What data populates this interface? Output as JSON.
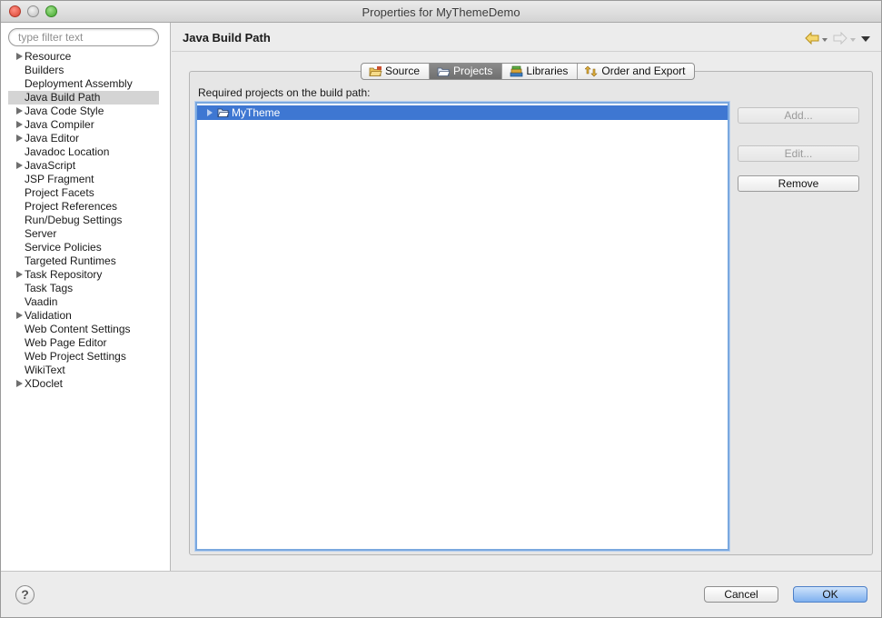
{
  "window": {
    "title": "Properties for MyThemeDemo"
  },
  "filter": {
    "placeholder": "type filter text",
    "value": ""
  },
  "tree": {
    "items": [
      {
        "label": "Resource",
        "expandable": true
      },
      {
        "label": "Builders",
        "expandable": false
      },
      {
        "label": "Deployment Assembly",
        "expandable": false
      },
      {
        "label": "Java Build Path",
        "expandable": false,
        "selected": true
      },
      {
        "label": "Java Code Style",
        "expandable": true
      },
      {
        "label": "Java Compiler",
        "expandable": true
      },
      {
        "label": "Java Editor",
        "expandable": true
      },
      {
        "label": "Javadoc Location",
        "expandable": false
      },
      {
        "label": "JavaScript",
        "expandable": true
      },
      {
        "label": "JSP Fragment",
        "expandable": false
      },
      {
        "label": "Project Facets",
        "expandable": false
      },
      {
        "label": "Project References",
        "expandable": false
      },
      {
        "label": "Run/Debug Settings",
        "expandable": false
      },
      {
        "label": "Server",
        "expandable": false
      },
      {
        "label": "Service Policies",
        "expandable": false
      },
      {
        "label": "Targeted Runtimes",
        "expandable": false
      },
      {
        "label": "Task Repository",
        "expandable": true
      },
      {
        "label": "Task Tags",
        "expandable": false
      },
      {
        "label": "Vaadin",
        "expandable": false
      },
      {
        "label": "Validation",
        "expandable": true
      },
      {
        "label": "Web Content Settings",
        "expandable": false
      },
      {
        "label": "Web Page Editor",
        "expandable": false
      },
      {
        "label": "Web Project Settings",
        "expandable": false
      },
      {
        "label": "WikiText",
        "expandable": false
      },
      {
        "label": "XDoclet",
        "expandable": true
      }
    ]
  },
  "page": {
    "title": "Java Build Path"
  },
  "tabs": [
    {
      "label": "Source",
      "icon": "source-folder-icon",
      "active": false
    },
    {
      "label": "Projects",
      "icon": "projects-folder-icon",
      "active": true
    },
    {
      "label": "Libraries",
      "icon": "libraries-books-icon",
      "active": false
    },
    {
      "label": "Order and Export",
      "icon": "order-export-icon",
      "active": false
    }
  ],
  "projects": {
    "label": "Required projects on the build path:",
    "items": [
      {
        "name": "MyTheme",
        "selected": true
      }
    ]
  },
  "buttons": {
    "add": "Add...",
    "edit": "Edit...",
    "remove": "Remove",
    "cancel": "Cancel",
    "ok": "OK",
    "help": "?"
  },
  "colors": {
    "selection": "#3e77d2",
    "active_tab": "#7c7c7c",
    "default_button": "#7fb0ef"
  }
}
